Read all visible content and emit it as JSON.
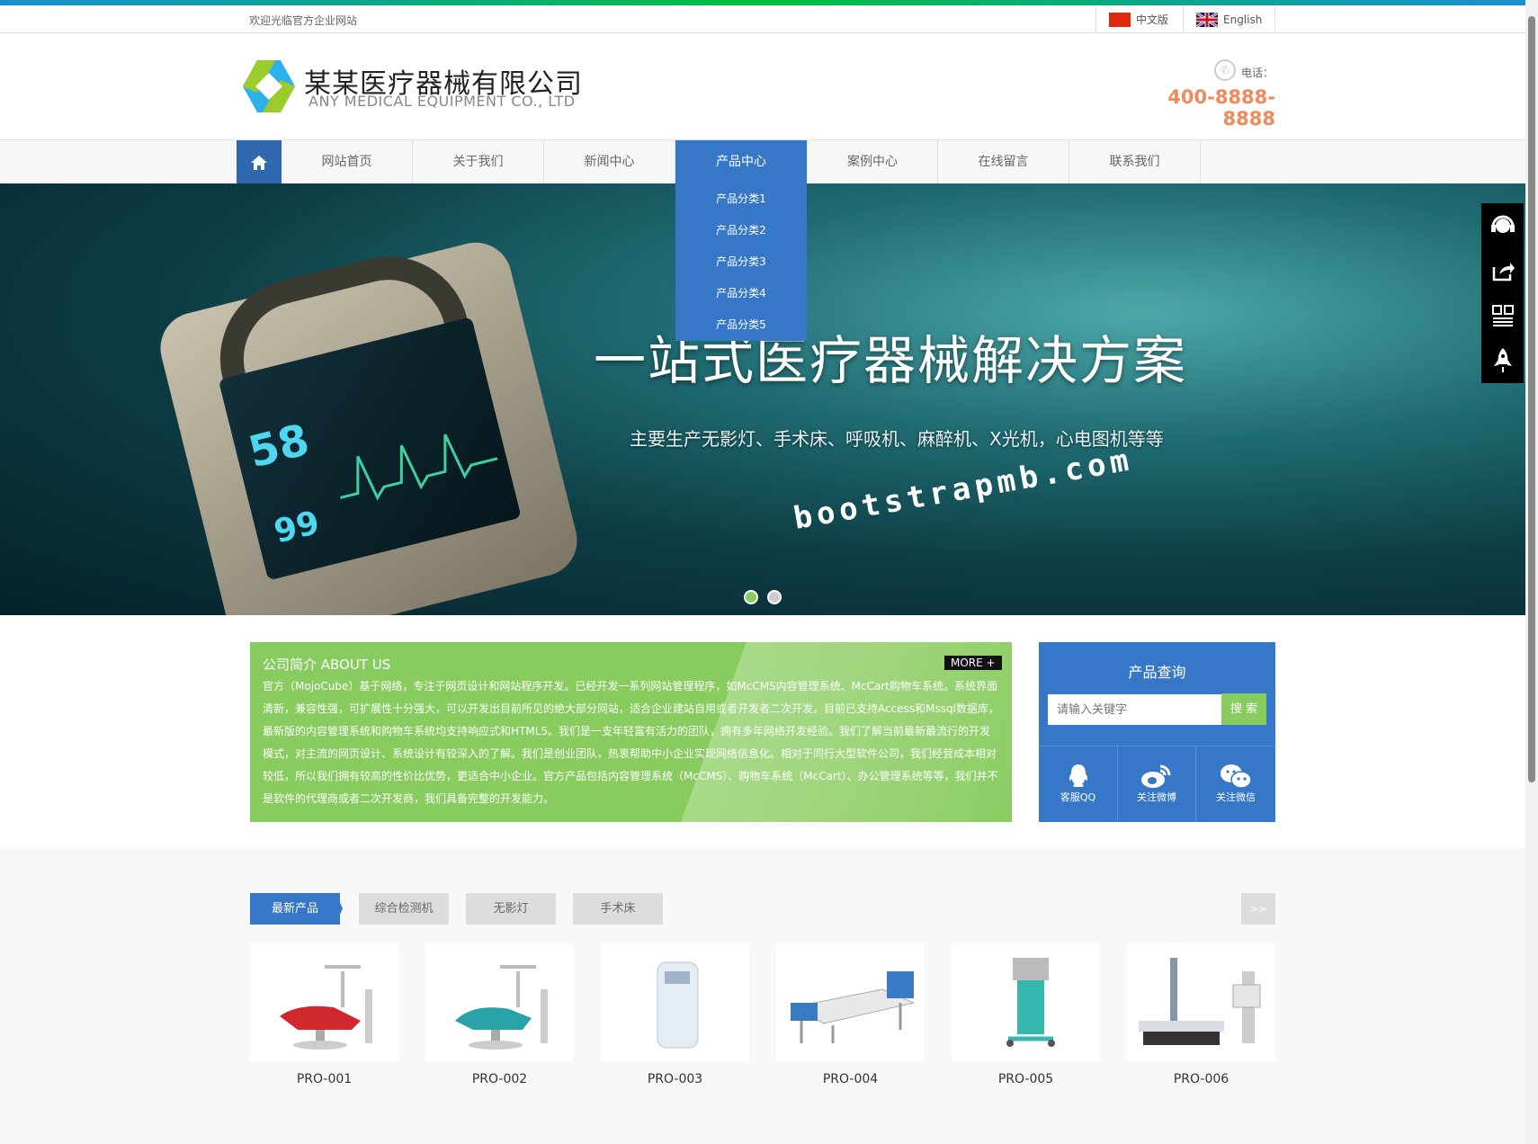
{
  "topbar": {
    "welcome": "欢迎光临官方企业网站",
    "lang_cn": "中文版",
    "lang_en": "English"
  },
  "header": {
    "company_cn": "某某医疗器械有限公司",
    "company_en": "ANY MEDICAL EQUIPMENT CO., LTD",
    "phone_label": "电话：",
    "phone": "400-8888-8888"
  },
  "nav": {
    "items": [
      "网站首页",
      "关于我们",
      "新闻中心",
      "产品中心",
      "案例中心",
      "在线留言",
      "联系我们"
    ],
    "active": 3,
    "dropdown": [
      "产品分类1",
      "产品分类2",
      "产品分类3",
      "产品分类4",
      "产品分类5"
    ]
  },
  "banner": {
    "title": "一站式医疗器械解决方案",
    "subtitle": "主要生产无影灯、手术床、呼吸机、麻醉机、X光机，心电图机等等",
    "watermark": "bootstrapmb.com",
    "monitor_values": [
      "58",
      "99"
    ],
    "slides": 2,
    "active_slide": 0
  },
  "about": {
    "title": "公司简介 ABOUT US",
    "more": "MORE +",
    "text": "官方（MojoCube）基于网络，专注于网页设计和网站程序开发。已经开发一系列网站管理程序，如McCMS内容管理系统、McCart购物车系统。系统界面清新，兼容性强，可扩展性十分强大，可以开发出目前所见的绝大部分网站，适合企业建站自用或者开发者二次开发。目前已支持Access和Mssql数据库，最新版的内容管理系统和购物车系统均支持响应式和HTML5。我们是一支年轻富有活力的团队，拥有多年网络开发经验。我们了解当前最新最流行的开发模式，对主流的网页设计、系统设计有较深入的了解。我们是创业团队，热衷帮助中小企业实现网络信息化。相对于同行大型软件公司，我们经营成本相对较低，所以我们拥有较高的性价比优势，更适合中小企业。官方产品包括内容管理系统（McCMS）、购物车系统（McCart）、办公管理系统等等，我们并不是软件的代理商或者二次开发商，我们具备完整的开发能力。"
  },
  "query": {
    "title": "产品查询",
    "placeholder": "请输入关键字",
    "button": "搜 索",
    "social": [
      "客服QQ",
      "关注微博",
      "关注微信"
    ]
  },
  "products": {
    "tabs": [
      "最新产品",
      "综合检测机",
      "无影灯",
      "手术床"
    ],
    "next": ">>",
    "items": [
      "PRO-001",
      "PRO-002",
      "PRO-003",
      "PRO-004",
      "PRO-005",
      "PRO-006"
    ]
  },
  "colors": {
    "primary": "#3777c8",
    "green": "#88cb5e",
    "phone": "#f08a5a"
  },
  "float_icons": [
    "headset-icon",
    "share-icon",
    "qrcode-icon",
    "rocket-icon"
  ]
}
